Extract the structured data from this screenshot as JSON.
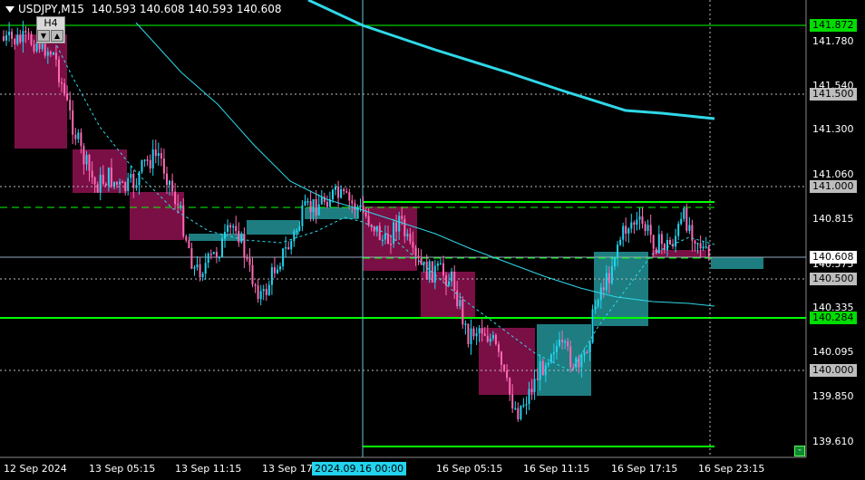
{
  "header": {
    "symbol_tf": "USDJPY,M15",
    "ohlc": "140.593 140.608 140.593 140.608"
  },
  "tf_box": {
    "label": "H4",
    "up": "▲",
    "down": "▼"
  },
  "price_axis": {
    "ticks": [
      "141.780",
      "141.540",
      "141.300",
      "141.060",
      "140.815",
      "140.575",
      "140.335",
      "140.095",
      "139.850",
      "139.610"
    ],
    "levels": [
      {
        "name": "level-141872",
        "text": "141.872",
        "bg": "#00dd00",
        "fg": "#000"
      },
      {
        "name": "level-141500",
        "text": "141.500",
        "bg": "#bdbdbd",
        "fg": "#000"
      },
      {
        "name": "level-141000",
        "text": "141.000",
        "bg": "#bdbdbd",
        "fg": "#000"
      },
      {
        "name": "level-current",
        "text": "140.608",
        "bg": "#ffffff",
        "fg": "#000"
      },
      {
        "name": "level-140500",
        "text": "140.500",
        "bg": "#bdbdbd",
        "fg": "#000"
      },
      {
        "name": "level-140284",
        "text": "140.284",
        "bg": "#00dd00",
        "fg": "#000"
      },
      {
        "name": "level-140000",
        "text": "140.000",
        "bg": "#bdbdbd",
        "fg": "#000"
      }
    ]
  },
  "time_axis": {
    "labels": [
      "12 Sep 2024",
      "13 Sep 05:15",
      "13 Sep 11:15",
      "13 Sep 17",
      "16 Sep 05:15",
      "16 Sep 11:15",
      "16 Sep 17:15",
      "16 Sep 23:15"
    ],
    "cursor_label": "2024.09.16 00:00"
  },
  "colors": {
    "bull": "#22d3ee",
    "bear": "#ff69b4",
    "bull_box": "#1d7d80",
    "bear_box": "#7a0f45",
    "ma": "#2fd8e8",
    "level": "#00ff00"
  }
}
